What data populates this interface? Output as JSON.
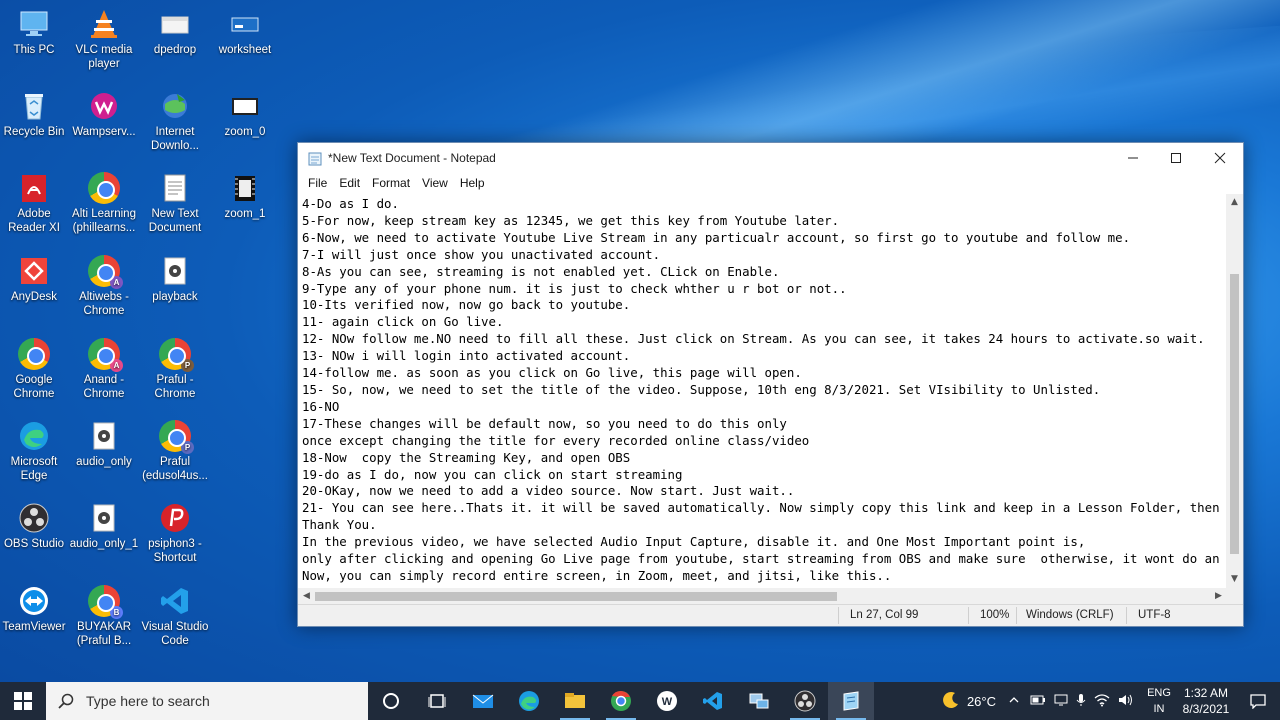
{
  "desktop": {
    "icons": [
      {
        "label": "This PC",
        "icon": "this-pc-icon"
      },
      {
        "label": "VLC media player",
        "icon": "vlc-icon"
      },
      {
        "label": "dpedrop",
        "icon": "folder-icon"
      },
      {
        "label": "worksheet",
        "icon": "shortcut-icon"
      },
      {
        "label": "Recycle Bin",
        "icon": "recycle-bin-icon"
      },
      {
        "label": "Wampserv...",
        "icon": "wampserver-icon"
      },
      {
        "label": "Internet Downlo...",
        "icon": "internet-download-icon"
      },
      {
        "label": "zoom_0",
        "icon": "video-file-icon"
      },
      {
        "label": "Adobe Reader XI",
        "icon": "adobe-reader-icon"
      },
      {
        "label": "Alti Learning (phillearns...",
        "icon": "chrome-icon"
      },
      {
        "label": "New Text Document",
        "icon": "text-document-icon"
      },
      {
        "label": "zoom_1",
        "icon": "video-file-icon"
      },
      {
        "label": "AnyDesk",
        "icon": "anydesk-icon"
      },
      {
        "label": "Altiwebs - Chrome",
        "icon": "chrome-icon"
      },
      {
        "label": "playback",
        "icon": "audio-file-icon"
      },
      {
        "label": "Google Chrome",
        "icon": "chrome-icon"
      },
      {
        "label": "Anand - Chrome",
        "icon": "chrome-icon"
      },
      {
        "label": "Praful - Chrome",
        "icon": "chrome-icon"
      },
      {
        "label": "Microsoft Edge",
        "icon": "edge-icon"
      },
      {
        "label": "audio_only",
        "icon": "audio-file-icon"
      },
      {
        "label": "Praful (edusol4us...",
        "icon": "chrome-icon"
      },
      {
        "label": "OBS Studio",
        "icon": "obs-icon"
      },
      {
        "label": "audio_only_1",
        "icon": "audio-file-icon"
      },
      {
        "label": "psiphon3 - Shortcut",
        "icon": "psiphon-icon"
      },
      {
        "label": "TeamViewer",
        "icon": "teamviewer-icon"
      },
      {
        "label": "BUYAKAR (Praful B...",
        "icon": "chrome-icon"
      },
      {
        "label": "Visual Studio Code",
        "icon": "vscode-icon"
      }
    ]
  },
  "notepad": {
    "title": "*New Text Document - Notepad",
    "menu": [
      "File",
      "Edit",
      "Format",
      "View",
      "Help"
    ],
    "lines": [
      "4-Do as I do.",
      "5-For now, keep stream key as 12345, we get this key from Youtube later.",
      "6-Now, we need to activate Youtube Live Stream in any particualr account, so first go to youtube and follow me.",
      "7-I will just once show you unactivated account.",
      "8-As you can see, streaming is not enabled yet. CLick on Enable.",
      "9-Type any of your phone num. it is just to check whther u r bot or not..",
      "10-Its verified now, now go back to youtube.",
      "11- again click on Go live.",
      "12- NOw follow me.NO need to fill all these. Just click on Stream. As you can see, it takes 24 hours to activate.so wait.",
      "13- NOw i will login into activated account.",
      "14-follow me. as soon as you click on Go live, this page will open.",
      "15- So, now, we need to set the title of the video. Suppose, 10th eng 8/3/2021. Set VIsibility to Unlisted.",
      "16-NO",
      "17-These changes will be default now, so you need to do this only",
      "once except changing the title for every recorded online class/video",
      "18-Now  copy the Streaming Key, and open OBS",
      "19-do as I do, now you can click on start streaming",
      "20-OKay, now we need to add a video source. Now start. Just wait..",
      "21- You can see here..Thats it. it will be saved automatically. Now simply copy this link and keep in a Lesson Folder, then",
      "Thank You.",
      "In the previous video, we have selected Audio Input Capture, disable it. and One Most Important point is,",
      "only after clicking and opening Go Live page from youtube, start streaming from OBS and make sure  otherwise, it wont do an",
      "Now, you can simply record entire screen, in Zoom, meet, and jitsi, like this.."
    ],
    "status": {
      "position": "Ln 27, Col 99",
      "zoom": "100%",
      "line_ending": "Windows (CRLF)",
      "encoding": "UTF-8"
    }
  },
  "taskbar": {
    "search_placeholder": "Type here to search",
    "apps": [
      "cortana-icon",
      "task-view-icon",
      "mail-icon",
      "edge-icon",
      "file-explorer-icon",
      "chrome-icon",
      "app-w-icon",
      "vscode-icon",
      "network-app-icon",
      "obs-icon",
      "notepad-icon"
    ],
    "weather": "26°C",
    "lang_line1": "ENG",
    "lang_line2": "IN",
    "time": "1:32 AM",
    "date": "8/3/2021"
  },
  "colors": {
    "desktop_blue": "#0d5cb8",
    "taskbar": "#1f2a3a",
    "accent": "#76b9ed"
  }
}
